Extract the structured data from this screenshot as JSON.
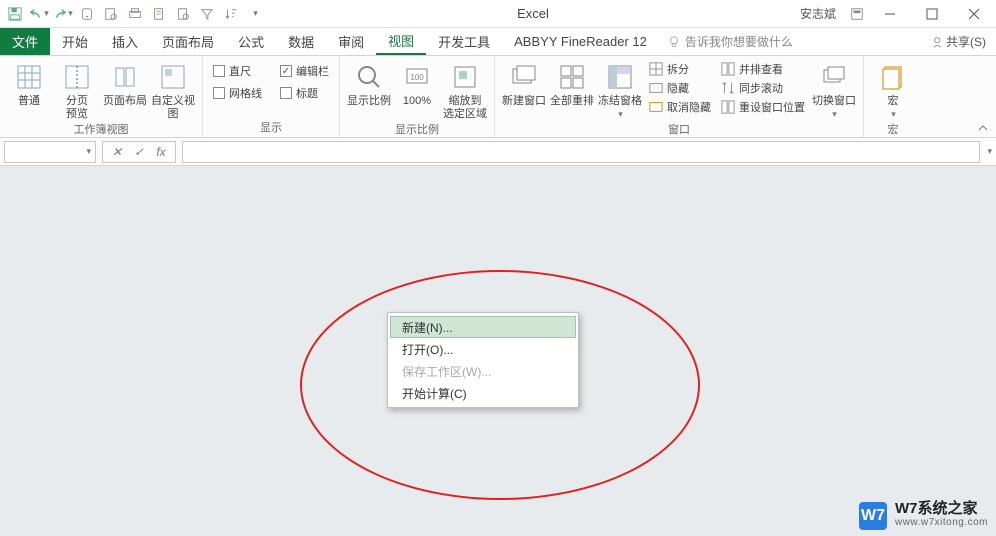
{
  "title": "Excel",
  "user": "安志斌",
  "qat_icons": [
    "save",
    "undo",
    "redo",
    "touch",
    "print-preview",
    "quick-print",
    "new",
    "open",
    "filter",
    "sort",
    "more"
  ],
  "tabs": {
    "file": "文件",
    "items": [
      "开始",
      "插入",
      "页面布局",
      "公式",
      "数据",
      "审阅",
      "视图",
      "开发工具",
      "ABBYY FineReader 12"
    ],
    "active_index": 6
  },
  "tellme": {
    "placeholder": "告诉我你想要做什么"
  },
  "share": "共享(S)",
  "ribbon": {
    "group1": {
      "label": "工作簿视图",
      "btns": [
        "普通",
        "分页\n预览",
        "页面布局",
        "自定义视图"
      ]
    },
    "group2": {
      "label": "显示",
      "chk_ruler": "直尺",
      "chk_formulabar": "编辑栏",
      "chk_gridlines": "网格线",
      "chk_headings": "标题"
    },
    "group3": {
      "label": "显示比例",
      "btns": [
        "显示比例",
        "100%",
        "缩放到\n选定区域"
      ]
    },
    "group4": {
      "label": "窗口",
      "big": [
        "新建窗口",
        "全部重排",
        "冻结窗格"
      ],
      "small": [
        "拆分",
        "隐藏",
        "取消隐藏",
        "并排查看",
        "同步滚动",
        "重设窗口位置",
        "切换窗口"
      ]
    },
    "group5": {
      "label": "宏",
      "btn": "宏"
    }
  },
  "formula_bar": {
    "cancel": "✕",
    "enter": "✓",
    "fx": "fx"
  },
  "context_menu": {
    "items": [
      {
        "label": "新建(N)...",
        "key": "N",
        "state": "hover"
      },
      {
        "label": "打开(O)...",
        "key": "O",
        "state": "normal"
      },
      {
        "label": "保存工作区(W)...",
        "key": "W",
        "state": "disabled"
      },
      {
        "label": "开始计算(C)",
        "key": "C",
        "state": "normal"
      }
    ]
  },
  "watermark": {
    "logo": "W7",
    "title": "W7系统之家",
    "url": "www.w7xitong.com"
  }
}
